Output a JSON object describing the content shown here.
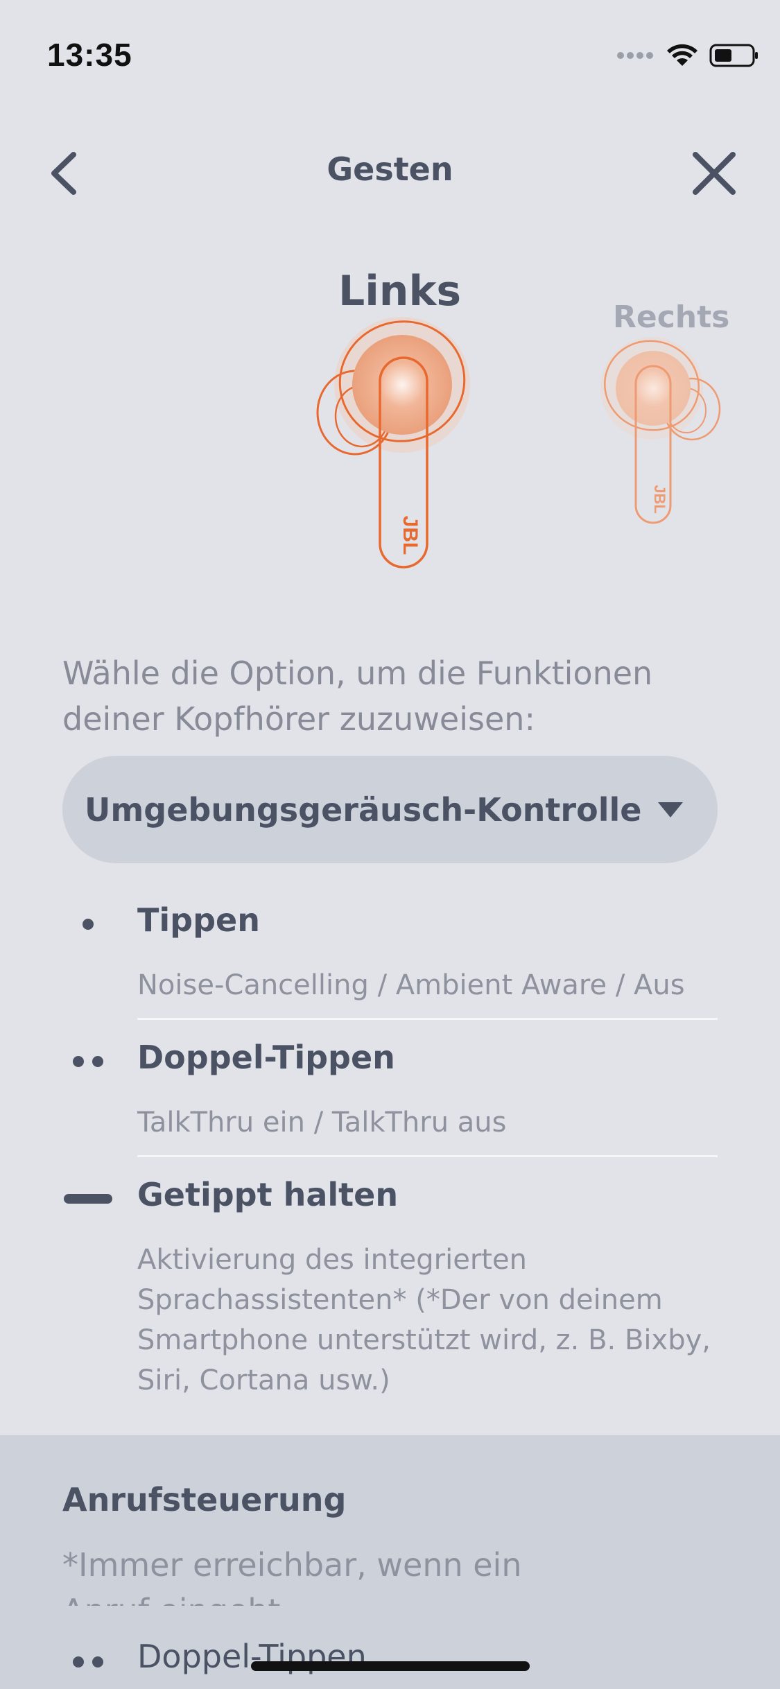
{
  "status_bar": {
    "time": "13:35"
  },
  "nav": {
    "title": "Gesten"
  },
  "earbuds": {
    "left_label": "Links",
    "right_label": "Rechts",
    "brand": "JBL",
    "accent_color": "#e8692f"
  },
  "instruction": "Wähle die Option, um die Funktionen deiner Kopfhörer zuzuweisen:",
  "dropdown": {
    "selected": "Umgebungsgeräusch-Kontrolle"
  },
  "gestures": [
    {
      "icon": "single-dot-icon",
      "title": "Tippen",
      "description": "Noise-Cancelling / Ambient Aware / Aus"
    },
    {
      "icon": "double-dot-icon",
      "title": "Doppel-Tippen",
      "description": "TalkThru ein / TalkThru aus"
    },
    {
      "icon": "hold-bar-icon",
      "title": "Getippt halten",
      "description": "Aktivierung des integrierten Sprachassistenten* (*Der von deinem Smartphone unterstützt wird, z. B. Bixby, Siri, Cortana usw.)"
    }
  ],
  "call_control": {
    "title": "Anrufsteuerung",
    "note": "*Immer erreichbar, wenn ein",
    "note_cont": "Anruf eingeht",
    "item_title": "Doppel-Tippen"
  }
}
